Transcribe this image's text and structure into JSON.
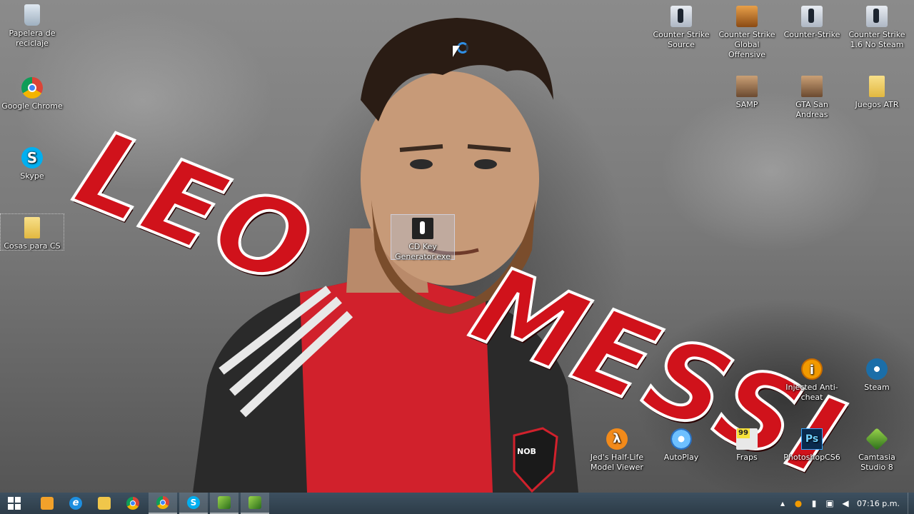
{
  "wallpaper": {
    "word1": "LEO",
    "word2": "MESSI",
    "shirt_badge": "NOB",
    "accent_color": "#d0121b"
  },
  "desktop_icons": {
    "recycle_bin": "Papelera de reciclaje",
    "chrome": "Google Chrome",
    "skype": "Skype",
    "cosas_cs": "Cosas para CS",
    "cs_source": "Counter Strike Source",
    "csgo": "Counter Strike Global Offensive",
    "counter_strike": "Counter-Strike",
    "cs16": "Counter Strike 1.6 No Steam",
    "samp": "SAMP",
    "gta_sa": "GTA San Andreas",
    "juegos_atr": "Juegos ATR",
    "cd_key": "CD Key Generator.exe",
    "injected": "Injected Anti-cheat",
    "steam": "Steam",
    "hl_model": "Jed's Half-Life Model Viewer",
    "autoplay": "AutoPlay",
    "fraps": "Fraps",
    "photoshop": "PhotoshopCS6",
    "camtasia": "Camtasia Studio 8"
  },
  "taskbar": {
    "clock": "07:16 p.m.",
    "tray_icons": [
      "chevron-up-icon",
      "anticheat-icon",
      "signal-icon",
      "network-icon",
      "volume-icon"
    ]
  }
}
